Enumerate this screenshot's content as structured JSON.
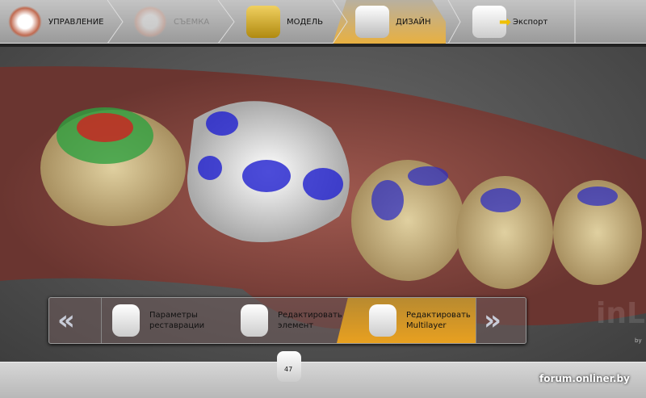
{
  "nav": {
    "steps": [
      {
        "label": "УПРАВЛЕНИЕ",
        "state": "normal"
      },
      {
        "label": "СЪЕМКА",
        "state": "disabled"
      },
      {
        "label": "МОДЕЛЬ",
        "state": "normal"
      },
      {
        "label": "ДИЗАЙН",
        "state": "active"
      },
      {
        "label": "Экспорт",
        "state": "normal"
      }
    ]
  },
  "toolbar": {
    "items": [
      {
        "line1": "Параметры",
        "line2": "реставрации"
      },
      {
        "line1": "Редактировать",
        "line2": "элемент"
      },
      {
        "line1": "Редактировать",
        "line2": "Multilayer"
      }
    ]
  },
  "brand": {
    "text": "inL",
    "by": "by"
  },
  "tooth": {
    "number": "47"
  },
  "watermark": "forum.onliner.by",
  "colors": {
    "active": "#e8a820",
    "gum": "#8a4a42",
    "tooth": "#c8b890"
  }
}
